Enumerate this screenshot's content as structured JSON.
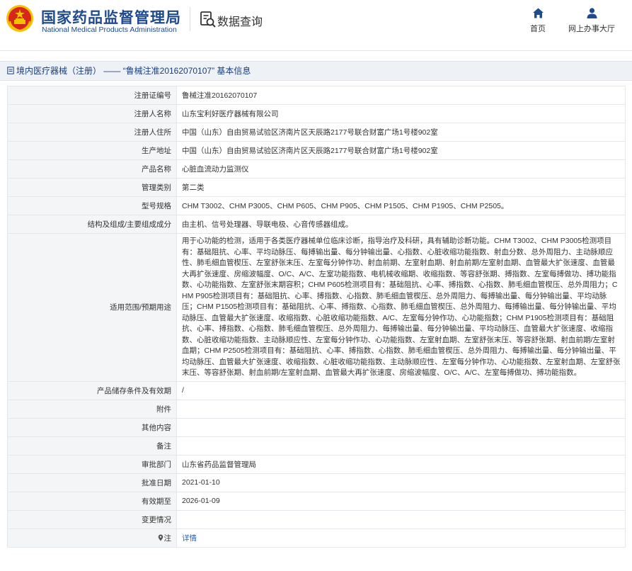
{
  "header": {
    "title_cn": "国家药品监督管理局",
    "title_en": "National Medical Products Administration",
    "data_query": "数据查询",
    "nav": [
      {
        "label": "首页",
        "icon": "home-icon"
      },
      {
        "label": "网上办事大厅",
        "icon": "user-icon"
      }
    ]
  },
  "breadcrumb": {
    "text": "境内医疗器械（注册） —— “鲁械注准20162070107” 基本信息"
  },
  "rows": [
    {
      "label": "注册证编号",
      "value": "鲁械注准20162070107"
    },
    {
      "label": "注册人名称",
      "value": "山东宝利好医疗器械有限公司"
    },
    {
      "label": "注册人住所",
      "value": "中国（山东）自由贸易试验区济南片区天辰路2177号联合财富广场1号楼902室"
    },
    {
      "label": "生产地址",
      "value": "中国（山东）自由贸易试验区济南片区天辰路2177号联合财富广场1号楼902室"
    },
    {
      "label": "产品名称",
      "value": "心脏血流动力监测仪"
    },
    {
      "label": "管理类别",
      "value": "第二类"
    },
    {
      "label": "型号规格",
      "value": "CHM T3002、CHM P3005、CHM P605、CHM P905、CHM P1505、CHM P1905、CHM P2505。"
    },
    {
      "label": "结构及组成/主要组成成分",
      "value": "由主机、信号处理器、导联电极、心音传感器组成。"
    },
    {
      "label": "适用范围/预期用途",
      "value": "用于心功能的检测，适用于各类医疗器械单位临床诊断，指导治疗及科研，具有辅助诊断功能。CHM T3002、CHM P3005检测项目有：基础阻抗、心率、平均动脉压、每搏输出量、每分钟输出量、心指数、心脏收缩功能指数、射血分数、总外周阻力、主动脉顺应性、肺毛细血管楔压、左室舒张末压、左室每分钟作功、射血前期、左室射血期、射血前期/左室射血期、血管最大扩张速度、血管最大再扩张速度、房缩波幅度、O/C、A/C、左室功能指数、电机械收缩期、收缩指数、等容舒张期、搏指数、左室每搏做功、搏功能指数、心功能指数、左室舒张末期容积；CHM P605检测项目有：基础阻抗、心率、搏指数、心指数、肺毛细血管楔压、总外周阻力；CHM P905检测项目有：基础阻抗、心率、搏指数、心指数、肺毛细血管楔压、总外周阻力、每搏输出量、每分钟输出量、平均动脉压；CHM P1505检测项目有：基础阻抗、心率、搏指数、心指数、肺毛细血管楔压、总外周阻力、每搏输出量、每分钟输出量、平均动脉压、血管最大扩张速度、收缩指数、心脏收缩功能指数、A/C、左室每分钟作功、心功能指数；CHM P1905检测项目有：基础阻抗、心率、搏指数、心指数、肺毛细血管楔压、总外周阻力、每搏输出量、每分钟输出量、平均动脉压、血管最大扩张速度、收缩指数、心脏收缩功能指数、主动脉顺应性、左室每分钟作功、心功能指数、左室射血期、左室舒张末压、等容舒张期、射血前期/左室射血期；CHM P2505检测项目有：基础阻抗、心率、搏指数、心指数、肺毛细血管楔压、总外周阻力、每搏输出量、每分钟输出量、平均动脉压、血管最大扩张速度、收缩指数、心脏收缩功能指数、主动脉顺应性、左室每分钟作功、心功能指数、左室射血期、左室舒张末压、等容舒张期、射血前期/左室射血期、血管最大再扩张速度、房缩波幅度、O/C、A/C、左室每搏做功、搏功能指数。"
    },
    {
      "label": "产品储存条件及有效期",
      "value": "/"
    },
    {
      "label": "附件",
      "value": ""
    },
    {
      "label": "其他内容",
      "value": ""
    },
    {
      "label": "备注",
      "value": ""
    },
    {
      "label": "审批部门",
      "value": "山东省药品监督管理局"
    },
    {
      "label": "批准日期",
      "value": "2021-01-10"
    },
    {
      "label": "有效期至",
      "value": "2026-01-09"
    },
    {
      "label": "变更情况",
      "value": ""
    }
  ],
  "note": {
    "label": "注",
    "link": "详情",
    "icon": "location-pin-icon"
  },
  "colors": {
    "brand_blue": "#1e4a8e",
    "emblem_red": "#d7261b",
    "emblem_gold": "#f5c200",
    "label_bg": "#f4f5f7",
    "link": "#2a63b8"
  }
}
